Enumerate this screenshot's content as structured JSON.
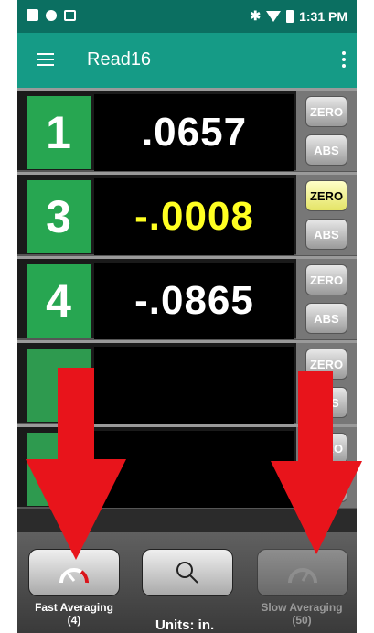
{
  "status": {
    "time": "1:31 PM",
    "bluetooth": "bluetooth-icon",
    "wifi": "wifi-icon",
    "battery": "battery-icon"
  },
  "appbar": {
    "title": "Read16"
  },
  "rows": [
    {
      "channel": "1",
      "reading": ".0657",
      "zero_label": "ZERO",
      "abs_label": "ABS"
    },
    {
      "channel": "3",
      "reading": "-.0008",
      "zero_label": "ZERO",
      "abs_label": "ABS"
    },
    {
      "channel": "4",
      "reading": "-.0865",
      "zero_label": "ZERO",
      "abs_label": "ABS"
    },
    {
      "channel": "",
      "reading": "",
      "zero_label": "ZERO",
      "abs_label": "ABS"
    },
    {
      "channel": "",
      "reading": "",
      "zero_label": "ZERO",
      "abs_label": "ABS"
    }
  ],
  "bottom": {
    "fast_label": "Fast Averaging",
    "fast_count": "(4)",
    "slow_label": "Slow Averaging",
    "slow_count": "(50)",
    "units": "Units: in."
  },
  "colors": {
    "appbar": "#159b86",
    "statusbar": "#0b6f61",
    "channel": "#27a651",
    "warn": "#ffff22",
    "arrow": "#e8141b"
  }
}
